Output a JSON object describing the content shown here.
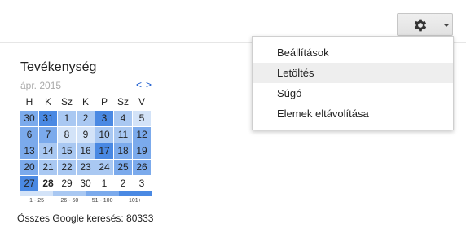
{
  "settings": {
    "menu": [
      {
        "label": "Beállítások",
        "active": false
      },
      {
        "label": "Letöltés",
        "active": true
      },
      {
        "label": "Súgó",
        "active": false
      },
      {
        "label": "Elemek eltávolítása",
        "active": false
      }
    ]
  },
  "activity": {
    "title": "Tevékenység",
    "month": "ápr. 2015",
    "nav_prev": "<",
    "nav_next": ">",
    "weekdays": [
      "H",
      "K",
      "Sz",
      "K",
      "P",
      "Sz",
      "V"
    ],
    "colors": {
      "level0": "#ffffff",
      "level1": "#d3e3f8",
      "level2": "#a9c8f2",
      "level3": "#7baaec",
      "level4": "#4a89e3"
    },
    "weeks": [
      [
        {
          "d": "30",
          "l": 3
        },
        {
          "d": "31",
          "l": 4
        },
        {
          "d": "1",
          "l": 2
        },
        {
          "d": "2",
          "l": 2
        },
        {
          "d": "3",
          "l": 4
        },
        {
          "d": "4",
          "l": 2
        },
        {
          "d": "5",
          "l": 1
        }
      ],
      [
        {
          "d": "6",
          "l": 3
        },
        {
          "d": "7",
          "l": 3
        },
        {
          "d": "8",
          "l": 1
        },
        {
          "d": "9",
          "l": 1
        },
        {
          "d": "10",
          "l": 2
        },
        {
          "d": "11",
          "l": 2
        },
        {
          "d": "12",
          "l": 3
        }
      ],
      [
        {
          "d": "13",
          "l": 3
        },
        {
          "d": "14",
          "l": 2
        },
        {
          "d": "15",
          "l": 2
        },
        {
          "d": "16",
          "l": 2
        },
        {
          "d": "17",
          "l": 4
        },
        {
          "d": "18",
          "l": 3
        },
        {
          "d": "19",
          "l": 3
        }
      ],
      [
        {
          "d": "20",
          "l": 3
        },
        {
          "d": "21",
          "l": 2
        },
        {
          "d": "22",
          "l": 2
        },
        {
          "d": "23",
          "l": 2
        },
        {
          "d": "24",
          "l": 2
        },
        {
          "d": "25",
          "l": 3
        },
        {
          "d": "26",
          "l": 3
        }
      ],
      [
        {
          "d": "27",
          "l": 4
        },
        {
          "d": "28",
          "l": 0,
          "bold": true
        },
        {
          "d": "29",
          "l": 0
        },
        {
          "d": "30",
          "l": 0
        },
        {
          "d": "1",
          "l": 0
        },
        {
          "d": "2",
          "l": 0
        },
        {
          "d": "3",
          "l": 0
        }
      ]
    ],
    "legend": [
      "1 - 25",
      "26 - 50",
      "51 - 100",
      "101+"
    ],
    "total_label": "Összes Google keresés: 80333"
  }
}
